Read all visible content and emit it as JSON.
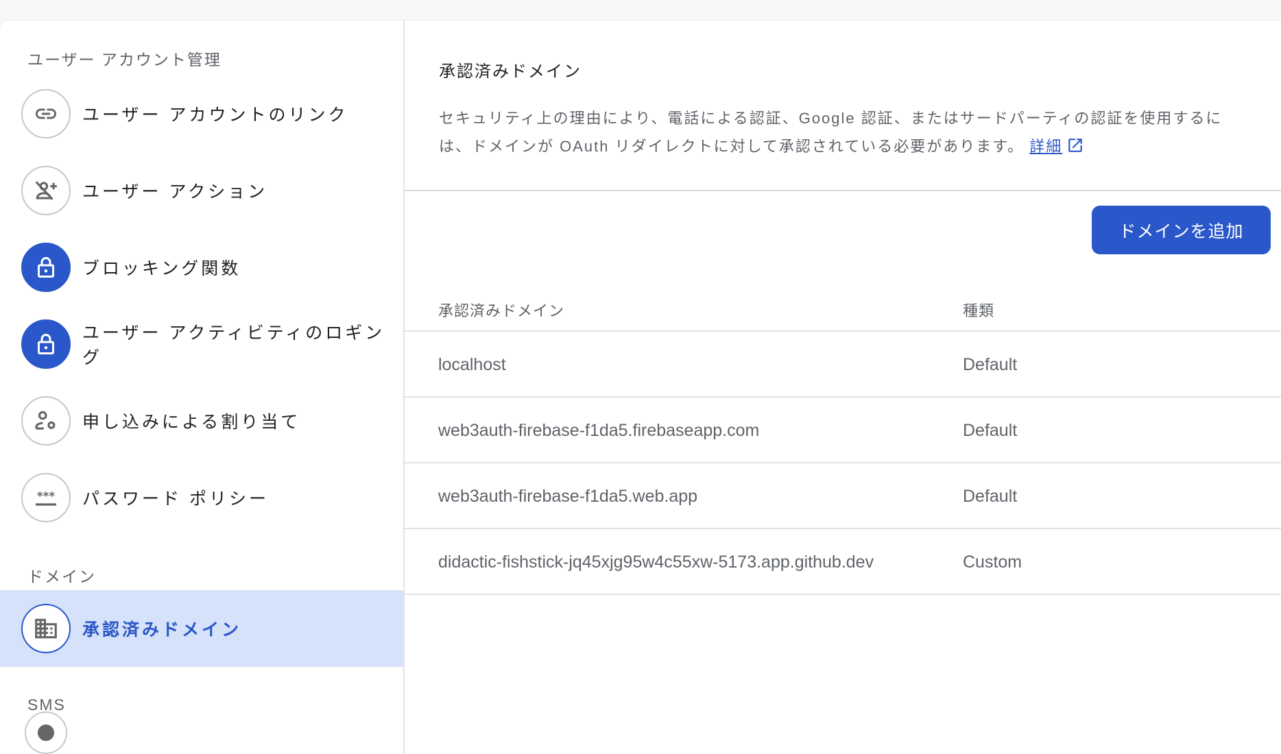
{
  "sidebar": {
    "sections": [
      {
        "label": "ユーザー アカウント管理",
        "items": [
          {
            "label": "ユーザー アカウントのリンク",
            "icon": "link-icon"
          },
          {
            "label": "ユーザー アクション",
            "icon": "person-add-disabled-icon"
          },
          {
            "label": "ブロッキング関数",
            "icon": "lock-icon"
          },
          {
            "label": "ユーザー アクティビティのロギング",
            "icon": "lock-icon"
          },
          {
            "label": "申し込みによる割り当て",
            "icon": "person-settings-icon"
          },
          {
            "label": "パスワード ポリシー",
            "icon": "password-icon"
          }
        ]
      },
      {
        "label": "ドメイン",
        "items": [
          {
            "label": "承認済みドメイン",
            "icon": "domain-icon",
            "selected": true
          }
        ]
      },
      {
        "label": "SMS",
        "items": []
      }
    ]
  },
  "main": {
    "title": "承認済みドメイン",
    "description": "セキュリティ上の理由により、電話による認証、Google 認証、またはサードパーティの認証を使用するには、ドメインが OAuth リダイレクトに対して承認されている必要があります。",
    "learn_more": "詳細",
    "add_button": "ドメインを追加",
    "table": {
      "columns": [
        "承認済みドメイン",
        "種類"
      ],
      "rows": [
        [
          "localhost",
          "Default"
        ],
        [
          "web3auth-firebase-f1da5.firebaseapp.com",
          "Default"
        ],
        [
          "web3auth-firebase-f1da5.web.app",
          "Default"
        ],
        [
          "didactic-fishstick-jq45xjg95w4c55xw-5173.app.github.dev",
          "Custom"
        ]
      ]
    }
  },
  "colors": {
    "accent": "#2a57c9",
    "selected_bg": "#d5e2fa"
  }
}
